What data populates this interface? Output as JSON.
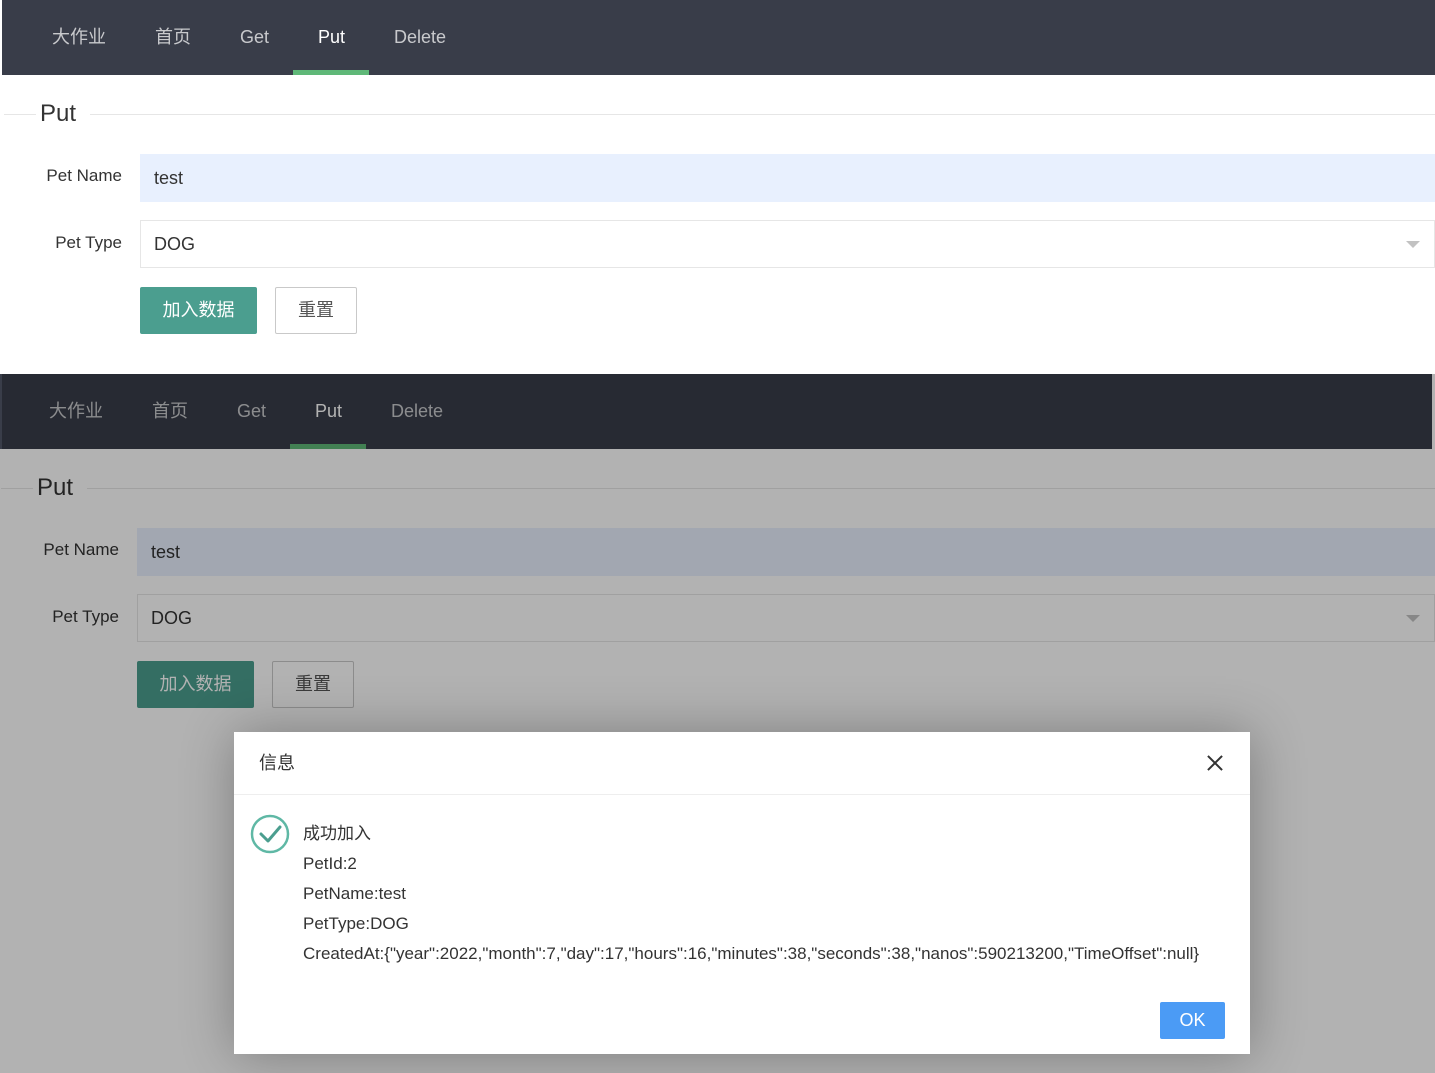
{
  "nav": {
    "items": [
      {
        "label": "大作业"
      },
      {
        "label": "首页"
      },
      {
        "label": "Get"
      },
      {
        "label": "Put"
      },
      {
        "label": "Delete"
      }
    ],
    "active_index": 3,
    "accent": "#5fb878"
  },
  "form": {
    "legend": "Put",
    "pet_name_label": "Pet Name",
    "pet_name_value": "test",
    "pet_type_label": "Pet Type",
    "pet_type_value": "DOG",
    "submit_label": "加入数据",
    "reset_label": "重置"
  },
  "dialog": {
    "title": "信息",
    "lines": [
      "成功加入",
      "PetId:2",
      "PetName:test",
      "PetType:DOG",
      "CreatedAt:{\"year\":2022,\"month\":7,\"day\":17,\"hours\":16,\"minutes\":38,\"seconds\":38,\"nanos\":590213200,\"TimeOffset\":null}"
    ],
    "ok_label": "OK",
    "icon": "check-circle-icon"
  }
}
